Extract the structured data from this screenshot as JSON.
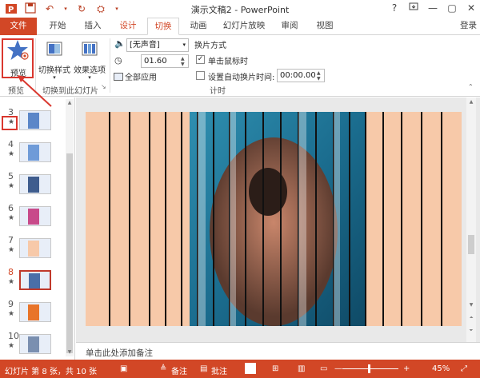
{
  "titlebar": {
    "title": "演示文稿2 - PowerPoint",
    "icons": [
      "powerpoint-logo",
      "save-icon",
      "undo-icon",
      "redo-icon",
      "customize-qat-icon"
    ],
    "window_controls": [
      "?",
      "▭",
      "—",
      "▢",
      "✕"
    ]
  },
  "tabs": {
    "file": "文件",
    "home": "开始",
    "insert": "插入",
    "design": "设计",
    "transitions": "切换",
    "animations": "动画",
    "slideshow": "幻灯片放映",
    "review": "审阅",
    "view": "视图",
    "login": "登录"
  },
  "ribbon": {
    "preview_label": "预览",
    "transition_styles_label": "切换样式",
    "effect_options_label": "效果选项",
    "sound_value": "[无声音]",
    "duration_value": "01.60",
    "apply_all_label": "全部应用",
    "advance_slide_heading": "换片方式",
    "on_click_label": "单击鼠标时",
    "on_click_checked": true,
    "after_label": "设置自动换片时间:",
    "after_checked": false,
    "after_value": "00:00.00",
    "groups": {
      "preview": "预览",
      "transition_to_slide": "切换到此幻灯片",
      "timing": "计时"
    }
  },
  "slides": [
    {
      "number": "3",
      "has_star": true,
      "selected": false
    },
    {
      "number": "4",
      "has_star": true,
      "selected": false
    },
    {
      "number": "5",
      "has_star": true,
      "selected": false
    },
    {
      "number": "6",
      "has_star": true,
      "selected": false
    },
    {
      "number": "7",
      "has_star": true,
      "selected": false
    },
    {
      "number": "8",
      "has_star": true,
      "selected": true
    },
    {
      "number": "9",
      "has_star": true,
      "selected": false
    },
    {
      "number": "10",
      "has_star": true,
      "selected": false
    }
  ],
  "star_glyph": "★",
  "notes_placeholder": "单击此处添加备注",
  "status": {
    "slide_info": "幻灯片 第 8 张，共 10 张",
    "notes_label": "备注",
    "comments_label": "批注",
    "zoom": "45%",
    "minus": "—",
    "plus": "+"
  },
  "colors": {
    "accent": "#d24726",
    "highlight": "#d9372e",
    "slide_bg": "#f7c9a9"
  }
}
